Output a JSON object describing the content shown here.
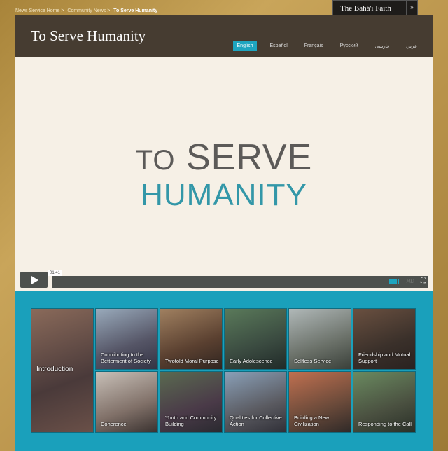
{
  "breadcrumb": [
    "News Service Home >",
    "Community News >",
    "To Serve Humanity"
  ],
  "faith_menu": {
    "label": "The Bahá'í Faith",
    "icon": "chevron-down-icon"
  },
  "header": {
    "title": "To Serve Humanity"
  },
  "languages": [
    {
      "label": "English",
      "active": true
    },
    {
      "label": "Español"
    },
    {
      "label": "Français"
    },
    {
      "label": "Русский"
    },
    {
      "label": "فارسی"
    },
    {
      "label": "عربي"
    }
  ],
  "video": {
    "title_line1_a": "TO",
    "title_line1_b": "SERVE",
    "title_line2": "HUMANITY",
    "time": "01:41",
    "hd": "HD",
    "accent": "#1ea5c0"
  },
  "tiles": [
    {
      "label": "Introduction",
      "bg": "linear-gradient(160deg,#8a6a5a,#4a3a3a 60%,#6a5048)"
    },
    {
      "label": "Contributing to the Betterment of Society",
      "bg": "linear-gradient(160deg,#9ab,#556 60%,#334)"
    },
    {
      "label": "Twofold Moral Purpose",
      "bg": "linear-gradient(160deg,#a08060,#5a4030 60%,#302520)"
    },
    {
      "label": "Early Adolescence",
      "bg": "linear-gradient(160deg,#5a7a5a,#3a4a40 60%,#202a28)"
    },
    {
      "label": "Selfless Service",
      "bg": "linear-gradient(160deg,#b0b8b8,#6a7068 60%,#3a403a)"
    },
    {
      "label": "Friendship and Mutual Support",
      "bg": "linear-gradient(160deg,#6a5040,#3a302a 60%,#2a2220)"
    },
    {
      "label": "Coherence",
      "bg": "linear-gradient(160deg,#c8c0b8,#807068 60%,#3a3230)"
    },
    {
      "label": "Youth and Community Building",
      "bg": "linear-gradient(160deg,#5a6a50,#4a3a48 60%,#2a2a30)"
    },
    {
      "label": "Qualities for Collective Action",
      "bg": "linear-gradient(160deg,#8aa0b8,#5a5a60 60%,#303038)"
    },
    {
      "label": "Building a New Civilization",
      "bg": "linear-gradient(160deg,#c07050,#6a4a3a 60%,#302a28)"
    },
    {
      "label": "Responding to the Call",
      "bg": "linear-gradient(160deg,#6a8a60,#4a5040 60%,#2a3028)"
    }
  ]
}
